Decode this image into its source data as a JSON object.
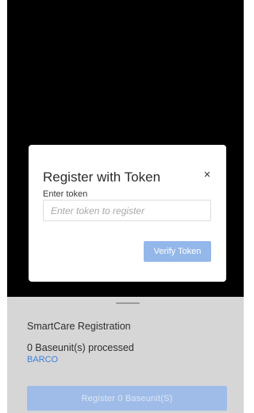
{
  "dialog": {
    "title": "Register with Token",
    "close_glyph": "×",
    "close_icon": "close-icon",
    "token_label": "Enter token",
    "token_placeholder": "Enter token to register",
    "token_value": "",
    "verify_label": "Verify Token"
  },
  "sheet": {
    "title": "SmartCare Registration",
    "processed_text": "0 Baseunit(s) processed",
    "brand": "BARCO",
    "register_label": "Register 0 Baseunit(S)"
  },
  "colors": {
    "overlay": "#000000",
    "sheet_bg": "#d6d6d6",
    "accent_disabled": "#9fbce8",
    "brand_link": "#3d7fe0"
  }
}
